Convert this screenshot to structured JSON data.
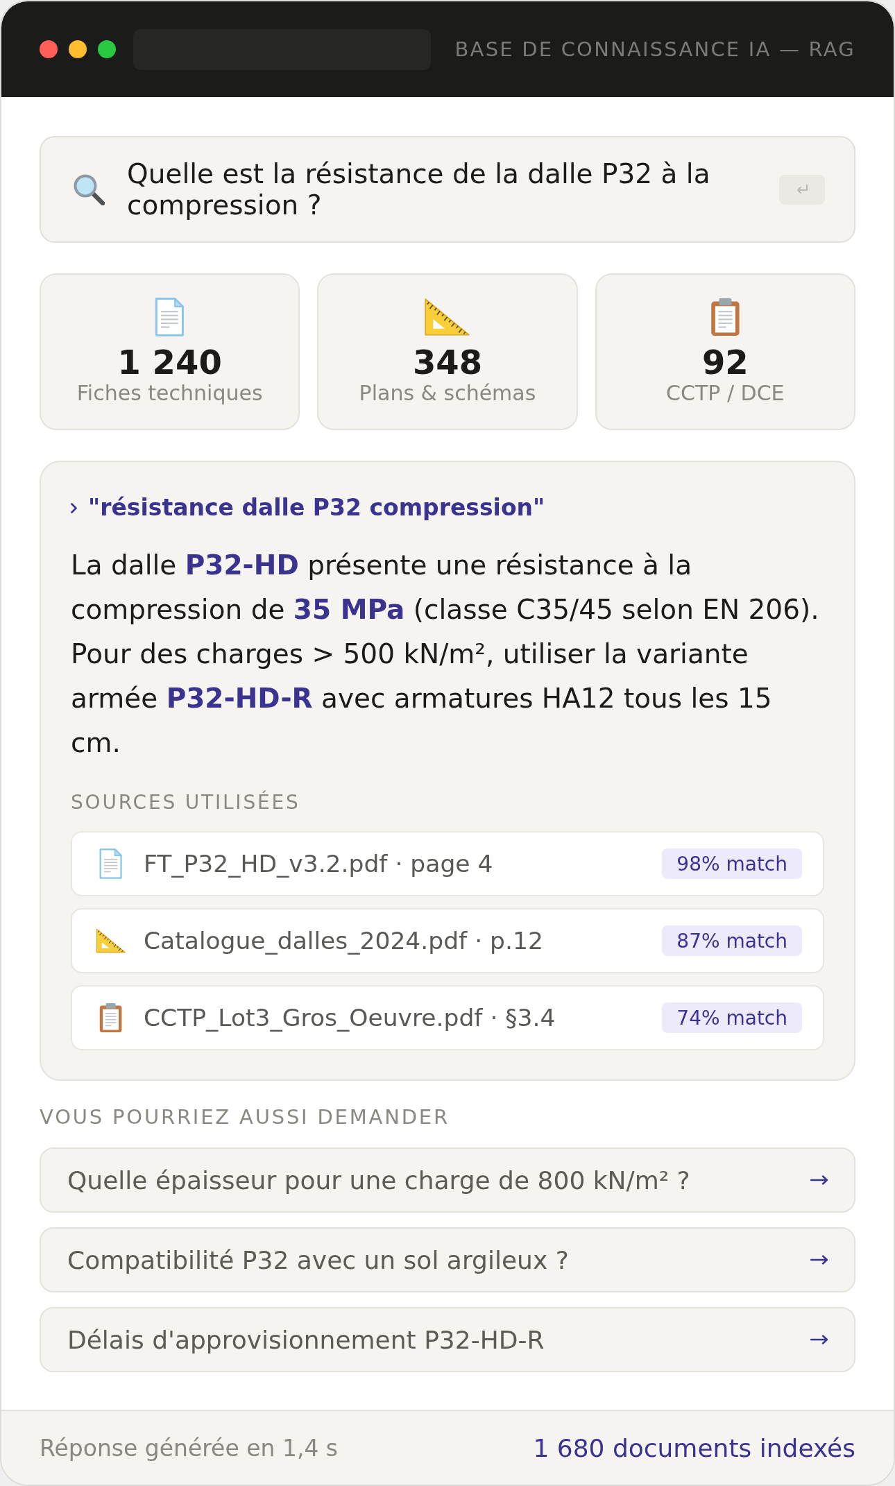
{
  "window": {
    "title": "BASE DE CONNAISSANCE IA — RAG"
  },
  "search": {
    "value": "Quelle est la résistance de la dalle P32 à la compression ?"
  },
  "stats": [
    {
      "kind": "document",
      "value": "1 240",
      "label": "Fiches techniques"
    },
    {
      "kind": "ruler",
      "value": "348",
      "label": "Plans & schémas"
    },
    {
      "kind": "clipboard",
      "value": "92",
      "label": "CCTP / DCE"
    }
  ],
  "answer": {
    "query": "\"résistance dalle P32 compression\"",
    "text": "La dalle **P32-HD** présente une résistance à la compression de **35 MPa** (classe C35/45 selon EN 206). Pour des charges > 500 kN/m², utiliser la variante armée **P32-HD-R** avec armatures HA12 tous les 15 cm.",
    "sources_heading": "SOURCES UTILISÉES",
    "sources": [
      {
        "kind": "document",
        "name": "FT_P32_HD_v3.2.pdf · page 4",
        "match": "98% match"
      },
      {
        "kind": "ruler",
        "name": "Catalogue_dalles_2024.pdf · p.12",
        "match": "87% match"
      },
      {
        "kind": "clipboard",
        "name": "CCTP_Lot3_Gros_Oeuvre.pdf · §3.4",
        "match": "74% match"
      }
    ]
  },
  "suggestions": {
    "heading": "VOUS POURRIEZ AUSSI DEMANDER",
    "items": [
      "Quelle épaisseur pour une charge de 800 kN/m² ?",
      "Compatibilité P32 avec un sol argileux ?",
      "Délais d'approvisionnement P32-HD-R"
    ]
  },
  "status_bar": {
    "left": "Réponse générée en 1,4 s",
    "right": "1 680 documents indexés"
  }
}
